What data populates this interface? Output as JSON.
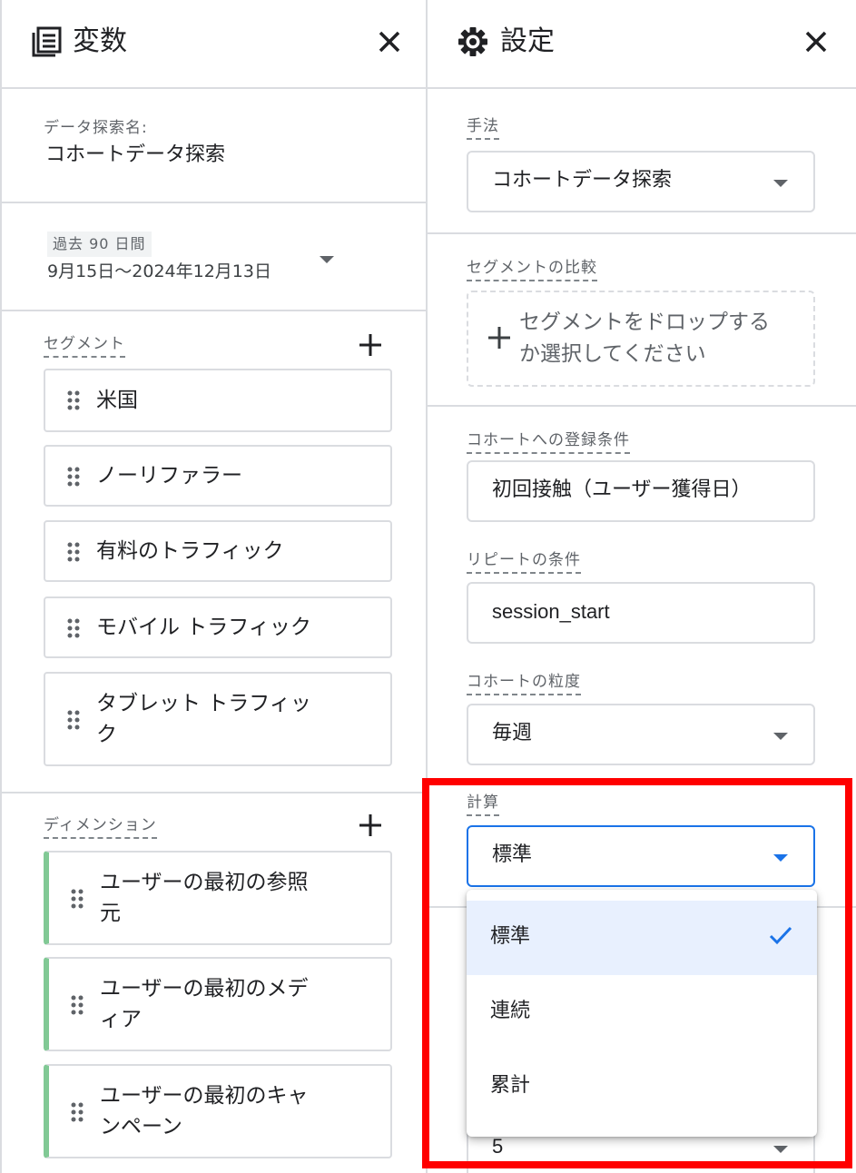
{
  "variables_panel": {
    "title": "変数",
    "icon": "variables-icon",
    "exploration_name_label": "データ探索名:",
    "exploration_name": "コホートデータ探索",
    "date_range": {
      "badge": "過去 90 日間",
      "range": "9月15日～2024年12月13日"
    },
    "segments": {
      "label": "セグメント",
      "items": [
        "米国",
        "ノーリファラー",
        "有料のトラフィック",
        "モバイル トラフィック",
        "タブレット トラフィッ\nク"
      ]
    },
    "dimensions": {
      "label": "ディメンション",
      "items": [
        "ユーザーの最初の参照\n元",
        "ユーザーの最初のメデ\nィア",
        "ユーザーの最初のキャ\nンペーン"
      ]
    }
  },
  "settings_panel": {
    "title": "設定",
    "icon": "gear-icon",
    "technique": {
      "label": "手法",
      "value": "コホートデータ探索"
    },
    "segment_comparison": {
      "label": "セグメントの比較",
      "drop_text": "セグメントをドロップする\nか選択してください"
    },
    "cohort_inclusion": {
      "label": "コホートへの登録条件",
      "value": "初回接触（ユーザー獲得日）"
    },
    "return_criteria": {
      "label": "リピートの条件",
      "value": "session_start"
    },
    "cohort_granularity": {
      "label": "コホートの粒度",
      "value": "毎週"
    },
    "calculation": {
      "label": "計算",
      "value": "標準",
      "options": [
        "標準",
        "連続",
        "累計"
      ],
      "selected_index": 0
    },
    "hidden_field_value": "5"
  },
  "colors": {
    "dimension_accent": "#81c995",
    "focus_blue": "#1a73e8",
    "highlight_red": "#ff0000",
    "selected_bg": "#e8f0fe"
  }
}
